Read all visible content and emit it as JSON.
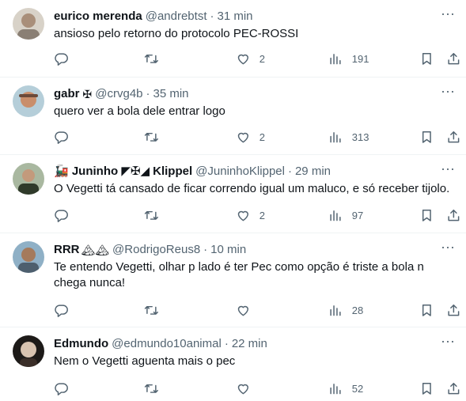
{
  "tweets": [
    {
      "name": "eurico merenda",
      "emoji": "",
      "handle": "@andrebtst",
      "separator": "·",
      "time": "31 min",
      "text": "ansioso pelo retorno do protocolo PEC-ROSSI",
      "replies": "",
      "retweets": "",
      "likes": "2",
      "views": "191",
      "avatar_color": "#8a7f74"
    },
    {
      "name": "gabr",
      "emoji": "✠",
      "handle": "@crvg4b",
      "separator": "·",
      "time": "35 min",
      "text": "quero ver a bola dele entrar logo",
      "replies": "",
      "retweets": "",
      "likes": "2",
      "views": "313",
      "avatar_color": "#c98e6b"
    },
    {
      "name": "🚂 Juninho ◤✠◢ Klippel",
      "emoji": "",
      "handle": "@JuninhoKlippel",
      "separator": "·",
      "time": "29 min",
      "text": "O Vegetti tá cansado de ficar correndo igual um maluco, e só receber tijolo.",
      "replies": "",
      "retweets": "",
      "likes": "2",
      "views": "97",
      "avatar_color": "#6d7a5c"
    },
    {
      "name": "RRR",
      "emoji": "🏔🏔",
      "handle": "@RodrigoReus8",
      "separator": "·",
      "time": "10 min",
      "text": "Te entendo Vegetti, olhar p lado é ter Pec como opção é triste a bola n chega nunca!",
      "replies": "",
      "retweets": "",
      "likes": "",
      "views": "28",
      "avatar_color": "#5f7f9a"
    },
    {
      "name": "Edmundo",
      "emoji": "",
      "handle": "@edmundo10animal",
      "separator": "·",
      "time": "22 min",
      "text": "Nem o Vegetti aguenta mais o pec",
      "replies": "",
      "retweets": "",
      "likes": "",
      "views": "52",
      "avatar_color": "#3a2e28"
    }
  ],
  "icons": {
    "more": "more-icon",
    "reply": "reply-icon",
    "retweet": "retweet-icon",
    "like": "heart-icon",
    "views": "views-icon",
    "bookmark": "bookmark-icon",
    "share": "share-icon"
  },
  "colors": {
    "text": "#0f1419",
    "secondary": "#536471",
    "divider": "#eff3f4"
  }
}
